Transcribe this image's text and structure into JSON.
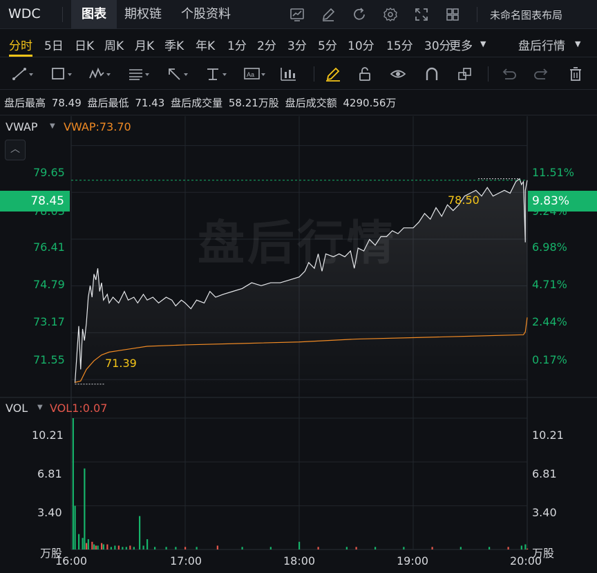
{
  "header": {
    "symbol": "WDC",
    "tabs": [
      "图表",
      "期权链",
      "个股资料"
    ],
    "active_tab": "图表",
    "icons": [
      "chart-icon",
      "edit-icon",
      "refresh-icon",
      "gear-icon",
      "fullscreen-icon",
      "grid-icon"
    ],
    "layout_name": "未命名图表布局"
  },
  "periods": {
    "items": [
      "分时",
      "5日",
      "日K",
      "周K",
      "月K",
      "季K",
      "年K",
      "1分",
      "2分",
      "3分",
      "5分",
      "10分",
      "15分",
      "30分",
      "更多"
    ],
    "active": "分时",
    "session_label": "盘后行情"
  },
  "drawing_tools": [
    "line-tool-icon",
    "rectangle-tool-icon",
    "wave-tool-icon",
    "fibonacci-tool-icon",
    "arrow-tool-icon",
    "text-tool-icon",
    "annotation-tool-icon",
    "candle-tool-icon",
    "pen-icon",
    "lock-icon",
    "eye-icon",
    "magnet-icon",
    "layers-icon",
    "undo-icon",
    "redo-icon",
    "trash-icon"
  ],
  "info": {
    "high_label": "盘后最高",
    "high_value": "78.49",
    "low_label": "盘后最低",
    "low_value": "71.43",
    "volume_label": "盘后成交量",
    "volume_value": "58.21万股",
    "amount_label": "盘后成交额",
    "amount_value": "4290.56万"
  },
  "main_pane": {
    "indicator": "VWAP",
    "indicator_value": "VWAP:73.70",
    "watermark": "盘后行情",
    "current_price": "78.45",
    "current_pct": "9.83%",
    "max_marker": "78.50",
    "min_marker": "71.39",
    "price_ticks": [
      "79.65",
      "78.03",
      "76.41",
      "74.79",
      "73.17",
      "71.55"
    ],
    "pct_ticks": [
      "11.51%",
      "9.24%",
      "6.98%",
      "4.71%",
      "2.44%",
      "0.17%"
    ]
  },
  "vol_pane": {
    "indicator": "VOL",
    "indicator_value": "VOL1:0.07",
    "left_ticks": [
      "10.21",
      "6.81",
      "3.40"
    ],
    "right_ticks": [
      "10.21",
      "6.81",
      "3.40"
    ],
    "unit": "万股"
  },
  "time_axis": [
    "16:00",
    "17:00",
    "18:00",
    "19:00",
    "20:00"
  ],
  "colors": {
    "up": "#16b36a",
    "down": "#e3564b",
    "vwap": "#f08a24",
    "price_line": "#e6e8eb",
    "accent": "#f5c518"
  },
  "chart_data": {
    "type": "line",
    "x_range": [
      "16:00",
      "20:00"
    ],
    "y_range": [
      70.93,
      80.19
    ],
    "price": [
      [
        "16:02",
        71.43
      ],
      [
        "16:04",
        73.4
      ],
      [
        "16:05",
        71.9
      ],
      [
        "16:06",
        73.3
      ],
      [
        "16:07",
        72.9
      ],
      [
        "16:08",
        73.5
      ],
      [
        "16:09",
        74.4
      ],
      [
        "16:10",
        74.8
      ],
      [
        "16:11",
        74.4
      ],
      [
        "16:12",
        75.2
      ],
      [
        "16:13",
        75.0
      ],
      [
        "16:14",
        75.4
      ],
      [
        "16:15",
        74.6
      ],
      [
        "16:16",
        74.9
      ],
      [
        "16:17",
        74.3
      ],
      [
        "16:19",
        74.5
      ],
      [
        "16:20",
        74.2
      ],
      [
        "16:22",
        74.4
      ],
      [
        "16:25",
        74.2
      ],
      [
        "16:28",
        74.6
      ],
      [
        "16:30",
        74.3
      ],
      [
        "16:33",
        74.4
      ],
      [
        "16:35",
        74.2
      ],
      [
        "16:38",
        74.5
      ],
      [
        "16:40",
        74.3
      ],
      [
        "16:43",
        74.4
      ],
      [
        "16:46",
        74.2
      ],
      [
        "16:50",
        74.4
      ],
      [
        "16:53",
        74.3
      ],
      [
        "16:55",
        74.1
      ],
      [
        "16:58",
        74.3
      ],
      [
        "17:00",
        74.2
      ],
      [
        "17:03",
        74.0
      ],
      [
        "17:06",
        74.3
      ],
      [
        "17:10",
        74.2
      ],
      [
        "17:13",
        74.6
      ],
      [
        "17:16",
        74.4
      ],
      [
        "17:20",
        74.5
      ],
      [
        "17:25",
        74.6
      ],
      [
        "17:30",
        74.7
      ],
      [
        "17:35",
        74.9
      ],
      [
        "17:40",
        74.8
      ],
      [
        "17:45",
        74.9
      ],
      [
        "17:50",
        74.9
      ],
      [
        "17:55",
        75.0
      ],
      [
        "18:00",
        75.1
      ],
      [
        "18:03",
        75.3
      ],
      [
        "18:05",
        75.6
      ],
      [
        "18:08",
        75.4
      ],
      [
        "18:10",
        75.9
      ],
      [
        "18:12",
        75.3
      ],
      [
        "18:14",
        75.9
      ],
      [
        "18:18",
        75.8
      ],
      [
        "18:21",
        75.9
      ],
      [
        "18:24",
        75.8
      ],
      [
        "18:27",
        76.0
      ],
      [
        "18:29",
        75.4
      ],
      [
        "18:31",
        76.1
      ],
      [
        "18:34",
        76.0
      ],
      [
        "18:37",
        76.4
      ],
      [
        "18:40",
        76.2
      ],
      [
        "18:43",
        76.5
      ],
      [
        "18:46",
        76.5
      ],
      [
        "18:49",
        76.7
      ],
      [
        "18:52",
        76.6
      ],
      [
        "18:55",
        76.8
      ],
      [
        "19:00",
        76.8
      ],
      [
        "19:03",
        77.0
      ],
      [
        "19:06",
        77.3
      ],
      [
        "19:09",
        77.1
      ],
      [
        "19:12",
        77.5
      ],
      [
        "19:15",
        77.2
      ],
      [
        "19:18",
        77.6
      ],
      [
        "19:21",
        77.4
      ],
      [
        "19:24",
        77.6
      ],
      [
        "19:27",
        77.9
      ],
      [
        "19:30",
        78.0
      ],
      [
        "19:33",
        78.1
      ],
      [
        "19:36",
        77.9
      ],
      [
        "19:39",
        78.2
      ],
      [
        "19:42",
        77.9
      ],
      [
        "19:45",
        78.0
      ],
      [
        "19:48",
        78.1
      ],
      [
        "19:51",
        78.0
      ],
      [
        "19:54",
        78.4
      ],
      [
        "19:56",
        78.5
      ],
      [
        "19:57",
        78.3
      ],
      [
        "19:58",
        78.4
      ],
      [
        "19:59",
        76.3
      ],
      [
        "19:59",
        78.1
      ],
      [
        "20:00",
        78.45
      ]
    ],
    "vwap": [
      [
        "16:02",
        71.45
      ],
      [
        "16:05",
        71.5
      ],
      [
        "16:08",
        71.9
      ],
      [
        "16:12",
        72.2
      ],
      [
        "16:16",
        72.4
      ],
      [
        "16:20",
        72.5
      ],
      [
        "16:30",
        72.6
      ],
      [
        "16:40",
        72.7
      ],
      [
        "17:00",
        72.75
      ],
      [
        "17:30",
        72.8
      ],
      [
        "18:00",
        72.85
      ],
      [
        "18:30",
        72.95
      ],
      [
        "19:00",
        73.0
      ],
      [
        "19:30",
        73.05
      ],
      [
        "19:58",
        73.1
      ],
      [
        "19:59",
        73.2
      ],
      [
        "20:00",
        73.7
      ]
    ],
    "volume": [
      [
        "16:01",
        10.21,
        "up"
      ],
      [
        "16:02",
        3.4,
        "up"
      ],
      [
        "16:04",
        1.2,
        "up"
      ],
      [
        "16:06",
        0.9,
        "up"
      ],
      [
        "16:07",
        6.3,
        "up"
      ],
      [
        "16:08",
        0.5,
        "down"
      ],
      [
        "16:09",
        0.8,
        "up"
      ],
      [
        "16:11",
        0.6,
        "down"
      ],
      [
        "16:12",
        0.4,
        "up"
      ],
      [
        "16:13",
        0.3,
        "down"
      ],
      [
        "16:14",
        0.3,
        "up"
      ],
      [
        "16:16",
        0.5,
        "down"
      ],
      [
        "16:17",
        0.4,
        "up"
      ],
      [
        "16:19",
        0.4,
        "down"
      ],
      [
        "16:21",
        0.2,
        "up"
      ],
      [
        "16:23",
        0.3,
        "up"
      ],
      [
        "16:25",
        0.3,
        "down"
      ],
      [
        "16:27",
        0.2,
        "up"
      ],
      [
        "16:29",
        0.2,
        "up"
      ],
      [
        "16:31",
        0.3,
        "down"
      ],
      [
        "16:33",
        0.2,
        "up"
      ],
      [
        "16:36",
        2.6,
        "up"
      ],
      [
        "16:38",
        0.3,
        "up"
      ],
      [
        "16:40",
        0.8,
        "up"
      ],
      [
        "16:44",
        0.2,
        "up"
      ],
      [
        "16:50",
        0.2,
        "up"
      ],
      [
        "16:55",
        0.2,
        "up"
      ],
      [
        "17:00",
        0.2,
        "down"
      ],
      [
        "17:06",
        0.2,
        "up"
      ],
      [
        "17:17",
        0.3,
        "down"
      ],
      [
        "17:30",
        0.2,
        "up"
      ],
      [
        "17:45",
        0.2,
        "up"
      ],
      [
        "18:00",
        0.6,
        "up"
      ],
      [
        "18:10",
        0.2,
        "down"
      ],
      [
        "18:25",
        0.2,
        "up"
      ],
      [
        "18:30",
        0.2,
        "down"
      ],
      [
        "18:40",
        0.2,
        "up"
      ],
      [
        "18:55",
        0.2,
        "up"
      ],
      [
        "19:10",
        0.2,
        "down"
      ],
      [
        "19:25",
        0.2,
        "up"
      ],
      [
        "19:40",
        0.2,
        "up"
      ],
      [
        "19:50",
        0.2,
        "down"
      ],
      [
        "19:57",
        0.3,
        "up"
      ],
      [
        "19:59",
        0.4,
        "up"
      ],
      [
        "20:00",
        0.07,
        "down"
      ]
    ],
    "volume_unit": "万股",
    "grid": true
  }
}
